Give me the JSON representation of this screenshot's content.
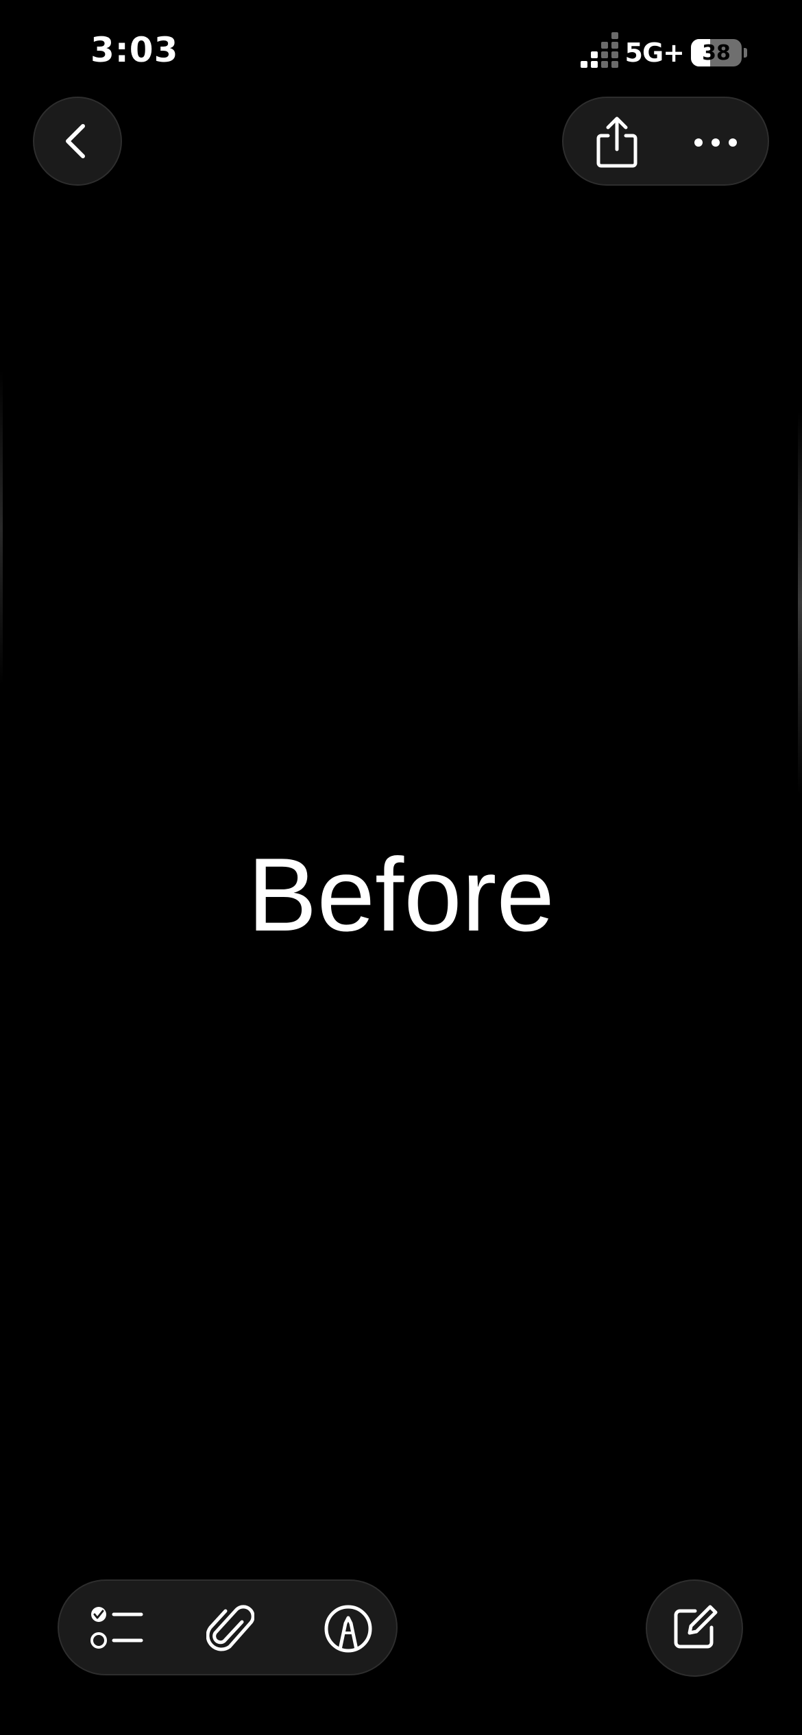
{
  "status_bar": {
    "time": "3:03",
    "network": "5G+",
    "battery_percent": "38",
    "battery_level": 0.38,
    "signal_strength": 2
  },
  "nav": {
    "back_icon": "chevron-left-icon",
    "share_icon": "share-icon",
    "more_icon": "ellipsis-icon"
  },
  "note": {
    "text": "Before"
  },
  "toolbar": {
    "items": [
      {
        "name": "checklist-icon"
      },
      {
        "name": "paperclip-icon"
      },
      {
        "name": "markup-pen-icon"
      }
    ],
    "compose_icon": "compose-icon"
  },
  "colors": {
    "background": "#000000",
    "glass": "#1b1b1b",
    "glass_border": "#2e2e2e",
    "foreground": "#ffffff"
  }
}
